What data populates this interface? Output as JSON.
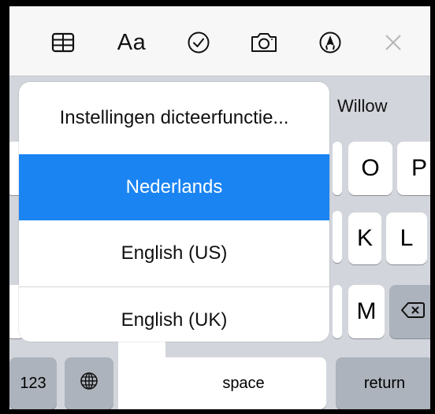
{
  "toolbar": {
    "items": [
      {
        "icon": "table-icon"
      },
      {
        "icon": "text-format-icon",
        "label": "Aa"
      },
      {
        "icon": "checkmark-circle-icon"
      },
      {
        "icon": "camera-icon"
      },
      {
        "icon": "markup-pen-icon"
      },
      {
        "icon": "close-icon"
      }
    ]
  },
  "suggestion_bar": {
    "visible_word": "Willow"
  },
  "keyboard": {
    "keys": {
      "o": "O",
      "p": "P",
      "k": "K",
      "l": "L",
      "m": "M",
      "numbers": "123",
      "space": "space",
      "return": "return"
    },
    "icons": {
      "globe": "globe-icon",
      "delete": "delete-backward-icon"
    }
  },
  "dictation_popover": {
    "settings_label": "Instellingen dicteerfunctie...",
    "languages": [
      {
        "label": "Nederlands",
        "selected": true
      },
      {
        "label": "English (US)",
        "selected": false
      },
      {
        "label": "English (UK)",
        "selected": false
      }
    ],
    "selected_color": "#1a84f3"
  }
}
